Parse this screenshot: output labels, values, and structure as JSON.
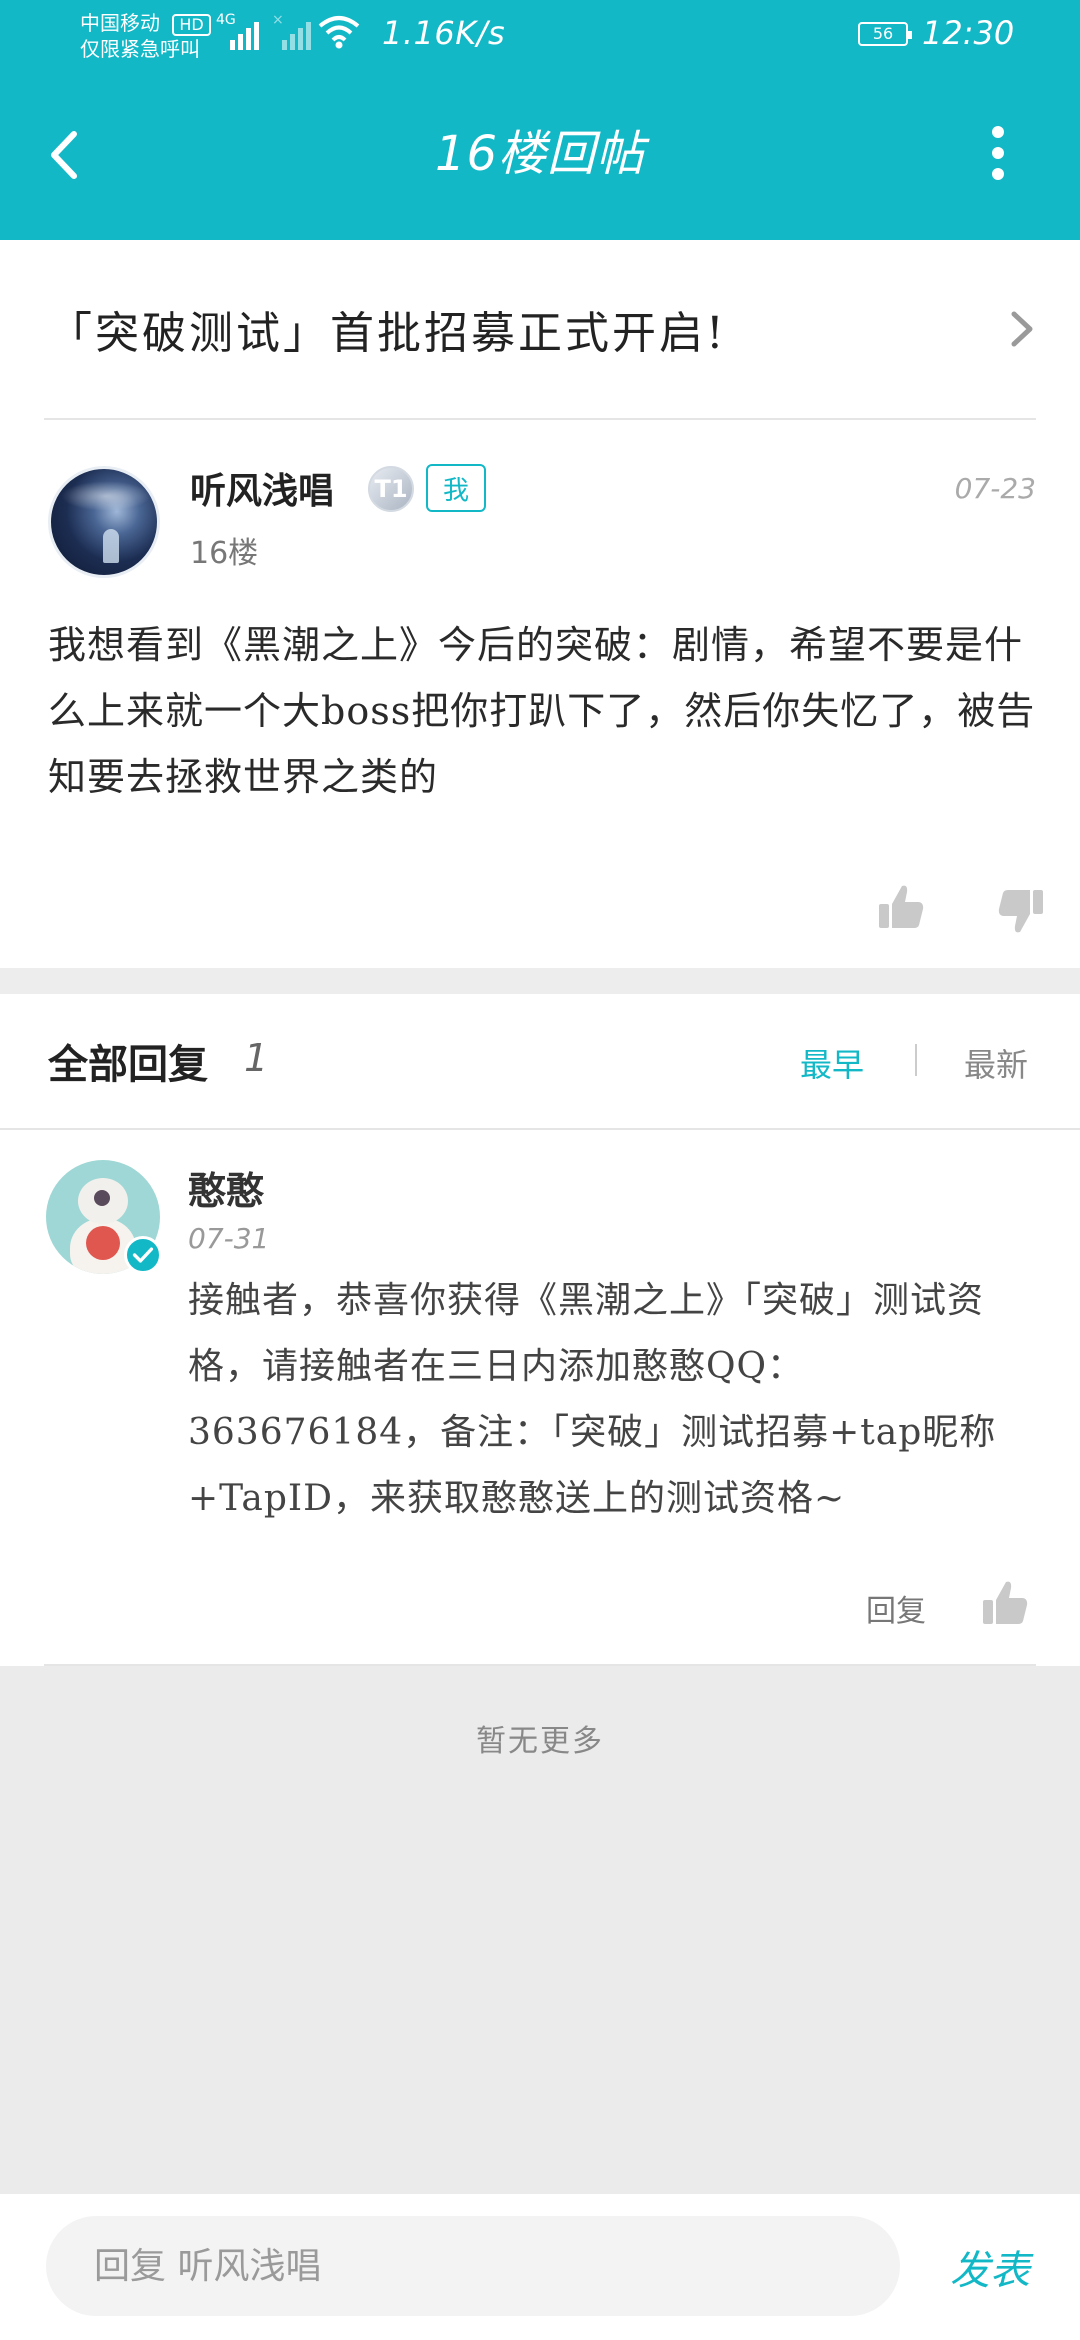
{
  "colors": {
    "accent": "#13B8C7",
    "text": "#222222",
    "muted": "#888888",
    "separator": "#EDEDED"
  },
  "status_bar": {
    "carrier": "中国移动",
    "hd": "HD",
    "emergency": "仅限紧急呼叫",
    "network": "4G",
    "net_speed": "1.16K/s",
    "battery": "56",
    "time": "12:30"
  },
  "header": {
    "title": "16楼回帖",
    "back_icon": "back-arrow-icon",
    "menu_icon": "more-vertical-icon"
  },
  "topic": {
    "title": "「突破测试」首批招募正式开启!",
    "icon": "chevron-right-icon"
  },
  "post": {
    "author": "听风浅唱",
    "level": "T1",
    "me_tag": "我",
    "floor": "16楼",
    "date": "07-23",
    "body": "我想看到《黑潮之上》今后的突破：剧情，希望不要是什么上来就一个大boss把你打趴下了，然后你失忆了，被告知要去拯救世界之类的",
    "like_icon": "thumbs-up-icon",
    "dislike_icon": "thumbs-down-icon"
  },
  "replies": {
    "title": "全部回复",
    "count": "1",
    "sort_earliest": "最早",
    "sort_newest": "最新",
    "items": [
      {
        "author": "憨憨",
        "date": "07-31",
        "body": "接触者，恭喜你获得《黑潮之上》「突破」测试资格，请接触者在三日内添加憨憨QQ：363676184，备注：「突破」测试招募+tap昵称+TapID，来获取憨憨送上的测试资格~",
        "reply_label": "回复"
      }
    ],
    "no_more": "暂无更多"
  },
  "input_bar": {
    "placeholder": "回复 听风浅唱",
    "send_label": "发表"
  }
}
